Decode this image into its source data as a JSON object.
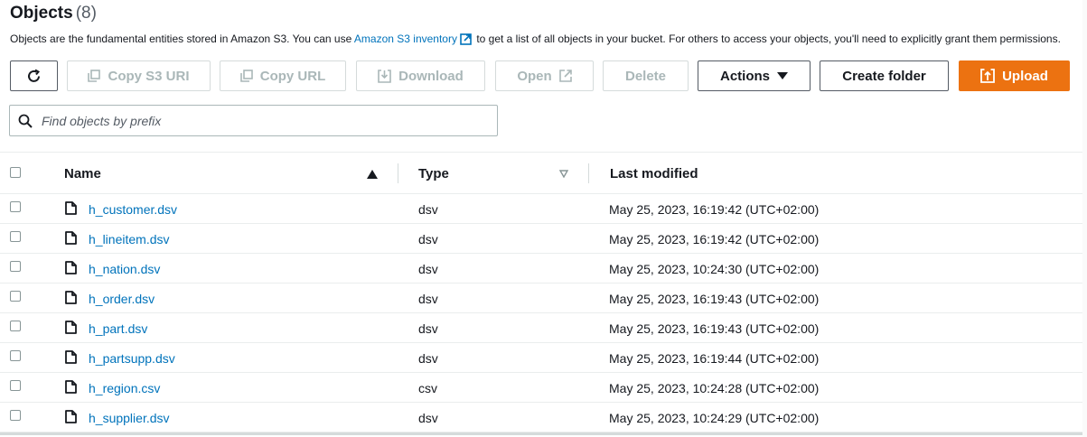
{
  "header": {
    "title": "Objects",
    "count": "(8)"
  },
  "description": {
    "before": "Objects are the fundamental entities stored in Amazon S3. You can use ",
    "link": "Amazon S3 inventory",
    "after": " to get a list of all objects in your bucket. For others to access your objects, you'll need to explicitly grant them permissions."
  },
  "toolbar": {
    "copy_s3_uri": "Copy S3 URI",
    "copy_url": "Copy URL",
    "download": "Download",
    "open": "Open",
    "delete": "Delete",
    "actions": "Actions",
    "create_folder": "Create folder",
    "upload": "Upload"
  },
  "search": {
    "placeholder": "Find objects by prefix"
  },
  "table": {
    "columns": {
      "name": "Name",
      "type": "Type",
      "last_modified": "Last modified"
    },
    "rows": [
      {
        "name": "h_customer.dsv",
        "type": "dsv",
        "modified": "May 25, 2023, 16:19:42 (UTC+02:00)"
      },
      {
        "name": "h_lineitem.dsv",
        "type": "dsv",
        "modified": "May 25, 2023, 16:19:42 (UTC+02:00)"
      },
      {
        "name": "h_nation.dsv",
        "type": "dsv",
        "modified": "May 25, 2023, 10:24:30 (UTC+02:00)"
      },
      {
        "name": "h_order.dsv",
        "type": "dsv",
        "modified": "May 25, 2023, 16:19:43 (UTC+02:00)"
      },
      {
        "name": "h_part.dsv",
        "type": "dsv",
        "modified": "May 25, 2023, 16:19:43 (UTC+02:00)"
      },
      {
        "name": "h_partsupp.dsv",
        "type": "dsv",
        "modified": "May 25, 2023, 16:19:44 (UTC+02:00)"
      },
      {
        "name": "h_region.csv",
        "type": "csv",
        "modified": "May 25, 2023, 10:24:28 (UTC+02:00)"
      },
      {
        "name": "h_supplier.dsv",
        "type": "dsv",
        "modified": "May 25, 2023, 10:24:29 (UTC+02:00)"
      }
    ]
  },
  "colors": {
    "link": "#0073bb",
    "primary": "#ec7211",
    "disabled": "#aab7b8",
    "text": "#16191f"
  }
}
